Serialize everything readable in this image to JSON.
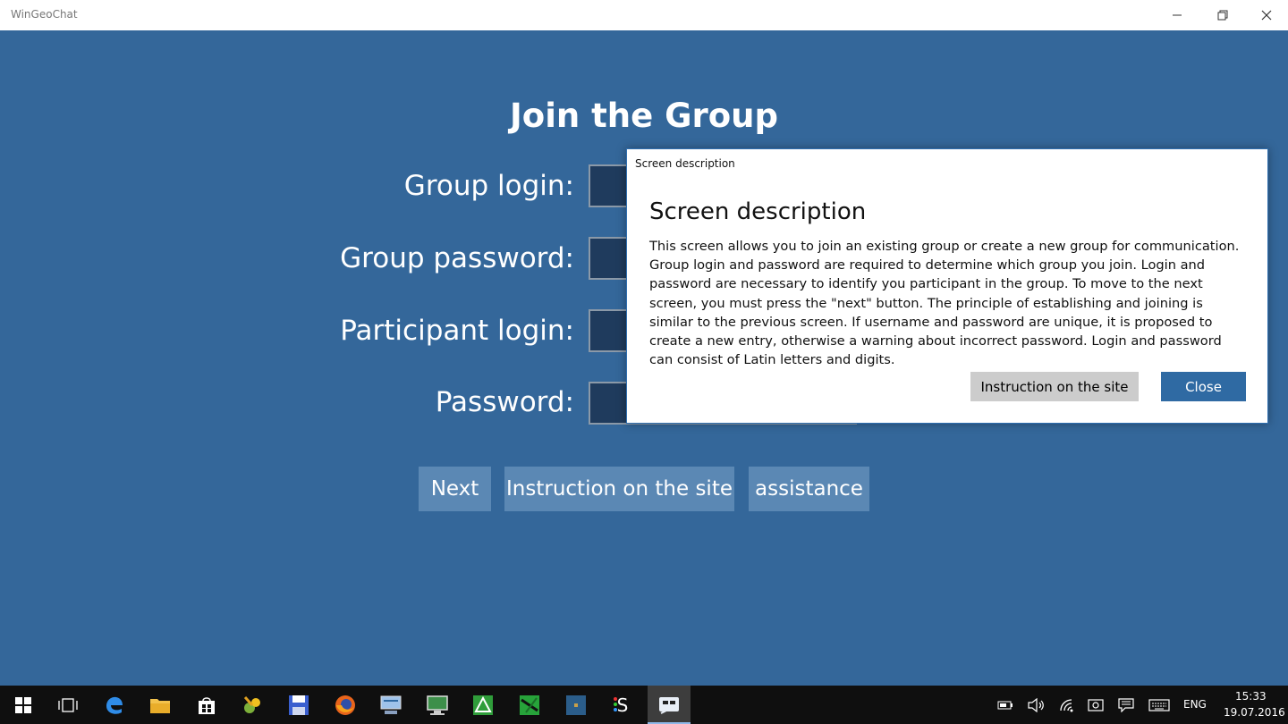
{
  "window": {
    "title": "WinGeoChat",
    "minimize_icon": "minimize-icon",
    "restore_icon": "restore-icon",
    "close_icon": "close-icon"
  },
  "page": {
    "title": "Join the Group",
    "fields": [
      {
        "label": "Group login:",
        "value": ""
      },
      {
        "label": "Group password:",
        "value": ""
      },
      {
        "label": "Participant login:",
        "value": ""
      },
      {
        "label": "Password:",
        "value": ""
      }
    ],
    "buttons": {
      "next": "Next",
      "instruction": "Instruction on the site",
      "assistance": "assistance"
    }
  },
  "dialog": {
    "caption": "Screen description",
    "heading": "Screen description",
    "body": "This screen allows you to join an existing group or create a new group for communication. Group login and password are required to determine which group you join. Login and password are necessary to identify you participant in the group. To move to the next screen, you must press the \"next\" button. The principle of establishing and joining is similar to the previous screen. If username and password are unique, it is proposed to create a new entry, otherwise a warning about incorrect password. Login and password can consist of Latin letters and digits.",
    "buttons": {
      "instruction": "Instruction on the site",
      "close": "Close"
    }
  },
  "taskbar": {
    "apps": [
      "start-icon",
      "task-view-icon",
      "edge-icon",
      "file-explorer-icon",
      "store-icon",
      "paint-app-icon",
      "floppy-app-icon",
      "firefox-icon",
      "network-app-icon",
      "remote-desktop-icon",
      "green-app-icon",
      "map-app-icon",
      "photo-app-icon",
      "skype-app-icon",
      "wingeochat-icon"
    ],
    "tray": {
      "language": "ENG",
      "time": "15:33",
      "date": "19.07.2016"
    }
  },
  "colors": {
    "app_background": "#34679a",
    "input_background": "#1f3b5d",
    "action_button": "#5b88b4",
    "dialog_primary_button": "#2f6aa3",
    "dialog_secondary_button": "#cccccc",
    "taskbar": "#0f0f0f"
  }
}
